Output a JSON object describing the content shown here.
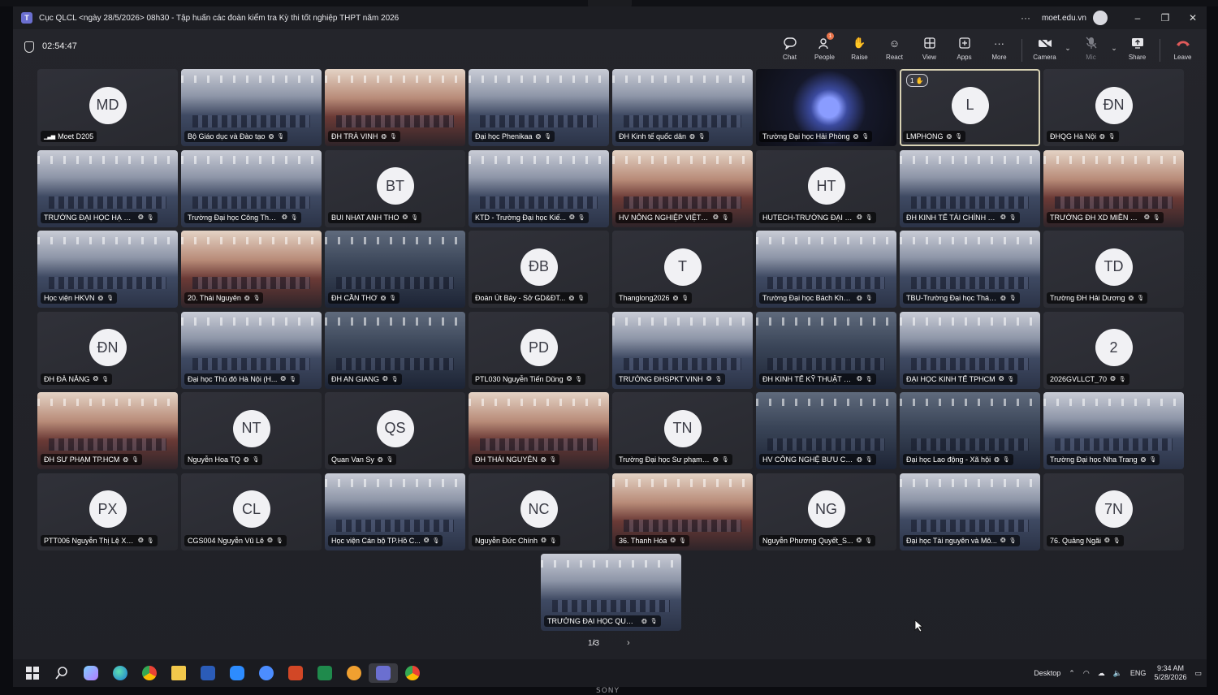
{
  "window": {
    "title": "Cục QLCL <ngày 28/5/2026> 08h30 - Tập huấn các đoàn kiểm tra Kỳ thi tốt nghiệp THPT năm 2026",
    "org": "moet.edu.vn",
    "more": "···",
    "minimize": "–",
    "maximize": "❐",
    "close": "✕"
  },
  "meeting": {
    "timer": "02:54:47",
    "tools": {
      "chat": "Chat",
      "people": "People",
      "people_badge": "1",
      "raise": "Raise",
      "react": "React",
      "view": "View",
      "apps": "Apps",
      "more": "More",
      "camera": "Camera",
      "mic": "Mic",
      "share": "Share",
      "leave": "Leave"
    }
  },
  "tiles": [
    {
      "name": "Moet D205",
      "initials": "MD",
      "kind": "avatar"
    },
    {
      "name": "Bộ Giáo dục và Đào tạo",
      "kind": "video"
    },
    {
      "name": "ĐH TRÀ VINH",
      "kind": "video",
      "tone": "warm"
    },
    {
      "name": "Đại học Phenikaa",
      "kind": "video"
    },
    {
      "name": "ĐH Kinh tế quốc dân",
      "kind": "video"
    },
    {
      "name": "Trường Đại học Hải Phòng",
      "kind": "video",
      "tone": "blur"
    },
    {
      "name": "LMPHONG",
      "initials": "L",
      "kind": "avatar",
      "hand": "1 ✋"
    },
    {
      "name": "ĐHQG Hà Nội",
      "initials": "ĐN",
      "kind": "avatar"
    },
    {
      "name": "TRƯỜNG ĐẠI HỌC HẠ LO...",
      "kind": "video"
    },
    {
      "name": "Trường Đại học Công Thư...",
      "kind": "video"
    },
    {
      "name": "BUI NHAT ANH THO",
      "initials": "BT",
      "kind": "avatar"
    },
    {
      "name": "KTD - Trường Đại học Kiế...",
      "kind": "video"
    },
    {
      "name": "HV NÔNG NGHIỆP VIỆT NAM",
      "kind": "video",
      "tone": "warm"
    },
    {
      "name": "HUTECH-TRƯỜNG ĐẠI H...",
      "initials": "HT",
      "kind": "avatar"
    },
    {
      "name": "ĐH KINH TẾ TÀI CHÍNH TP.H...",
      "kind": "video"
    },
    {
      "name": "TRƯỜNG ĐH XD MIỀN TÂY",
      "kind": "video",
      "tone": "warm"
    },
    {
      "name": "Học viện HKVN",
      "kind": "video"
    },
    {
      "name": "20. Thái Nguyên",
      "kind": "video",
      "tone": "warm"
    },
    {
      "name": "ĐH CẦN THƠ",
      "kind": "video",
      "tone": "dark"
    },
    {
      "name": "Đoàn Út Bảy - Sở GD&ĐT...",
      "initials": "ĐB",
      "kind": "avatar"
    },
    {
      "name": "Thanglong2026",
      "initials": "T",
      "kind": "avatar"
    },
    {
      "name": "Trường Đại học Bách Kho...",
      "kind": "video"
    },
    {
      "name": "TBU-Trường Đại học Thái ...",
      "kind": "video"
    },
    {
      "name": "Trường ĐH Hải Dương",
      "initials": "TD",
      "kind": "avatar"
    },
    {
      "name": "ĐH ĐÀ NẴNG",
      "initials": "ĐN",
      "kind": "avatar"
    },
    {
      "name": "Đại học Thủ đô Hà Nội (H...",
      "kind": "video"
    },
    {
      "name": "ĐH AN GIANG",
      "kind": "video",
      "tone": "dark"
    },
    {
      "name": "PTL030 Nguyễn Tiến Dũng",
      "initials": "PD",
      "kind": "avatar"
    },
    {
      "name": "TRƯỜNG ĐHSPKT VINH",
      "kind": "video"
    },
    {
      "name": "ĐH KINH TẾ KỸ THUẬT CÔNG...",
      "kind": "video",
      "tone": "dark"
    },
    {
      "name": "ĐẠI HỌC KINH TẾ TPHCM",
      "kind": "video"
    },
    {
      "name": "2026GVLLCT_70",
      "initials": "2",
      "kind": "avatar"
    },
    {
      "name": "ĐH SƯ PHẠM TP.HCM",
      "kind": "video",
      "tone": "warm"
    },
    {
      "name": "Nguyễn Hoa TQ",
      "initials": "NT",
      "kind": "avatar"
    },
    {
      "name": "Quan Van Sy",
      "initials": "QS",
      "kind": "avatar"
    },
    {
      "name": "ĐH THÁI NGUYÊN",
      "kind": "video",
      "tone": "warm"
    },
    {
      "name": "Trường Đại học Sư phạm ...",
      "initials": "TN",
      "kind": "avatar"
    },
    {
      "name": "HV CÔNG NGHỆ BƯU CHÍNH ...",
      "kind": "video",
      "tone": "dark"
    },
    {
      "name": "Đại học Lao động - Xã hội",
      "kind": "video",
      "tone": "dark"
    },
    {
      "name": "Trường Đại học Nha Trang",
      "kind": "video"
    },
    {
      "name": "PTT006 Nguyễn Thị Lệ Xu...",
      "initials": "PX",
      "kind": "avatar"
    },
    {
      "name": "CGS004 Nguyễn Vũ Lê",
      "initials": "CL",
      "kind": "avatar"
    },
    {
      "name": "Học viện Cán bộ TP.Hồ C...",
      "kind": "video"
    },
    {
      "name": "Nguyễn Đức Chính",
      "initials": "NC",
      "kind": "avatar"
    },
    {
      "name": "36. Thanh Hóa",
      "kind": "video",
      "tone": "warm"
    },
    {
      "name": "Nguyễn Phương Quyết_S...",
      "initials": "NG",
      "kind": "avatar"
    },
    {
      "name": "Đại học Tài nguyên và Mô...",
      "kind": "video"
    },
    {
      "name": "76. Quảng Ngãi",
      "initials": "7N",
      "kind": "avatar"
    },
    {
      "name": "TRƯỜNG ĐẠI HỌC QUỐC...",
      "kind": "video"
    }
  ],
  "pager": {
    "label": "1/3",
    "prev": "‹",
    "next": "›"
  },
  "taskbar": {
    "desktop": "Desktop",
    "lang": "ENG",
    "time": "9:34 AM",
    "date": "5/28/2026"
  },
  "bezel_brand": "SONY"
}
